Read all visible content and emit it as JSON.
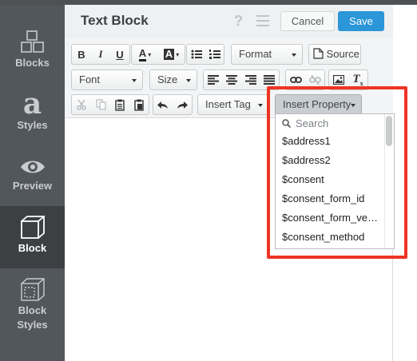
{
  "sidebar": {
    "items": [
      {
        "label": "Blocks",
        "icon": "blocks-icon"
      },
      {
        "label": "Styles",
        "icon": "styles-icon"
      },
      {
        "label": "Preview",
        "icon": "eye-icon"
      },
      {
        "label": "Block",
        "icon": "cube-icon"
      },
      {
        "label_line1": "Block",
        "label_line2": "Styles",
        "icon": "cube-outline-icon"
      }
    ]
  },
  "header": {
    "title": "Text Block",
    "help": "?",
    "cancel_label": "Cancel",
    "save_label": "Save"
  },
  "toolbar": {
    "bold": "B",
    "italic": "I",
    "underline": "U",
    "text_color": "A",
    "bg_color": "A",
    "format_label": "Format",
    "source_label": "Source",
    "font_label": "Font",
    "size_label": "Size",
    "insert_tag_label": "Insert Tag",
    "insert_property_label": "Insert Property"
  },
  "property_dropdown": {
    "search_placeholder": "Search",
    "options": [
      "$address1",
      "$address2",
      "$consent",
      "$consent_form_id",
      "$consent_form_version",
      "$consent_method"
    ]
  },
  "colors": {
    "accent": "#2b96d8",
    "highlight": "#ee3424",
    "sidebar": "#52575b"
  }
}
